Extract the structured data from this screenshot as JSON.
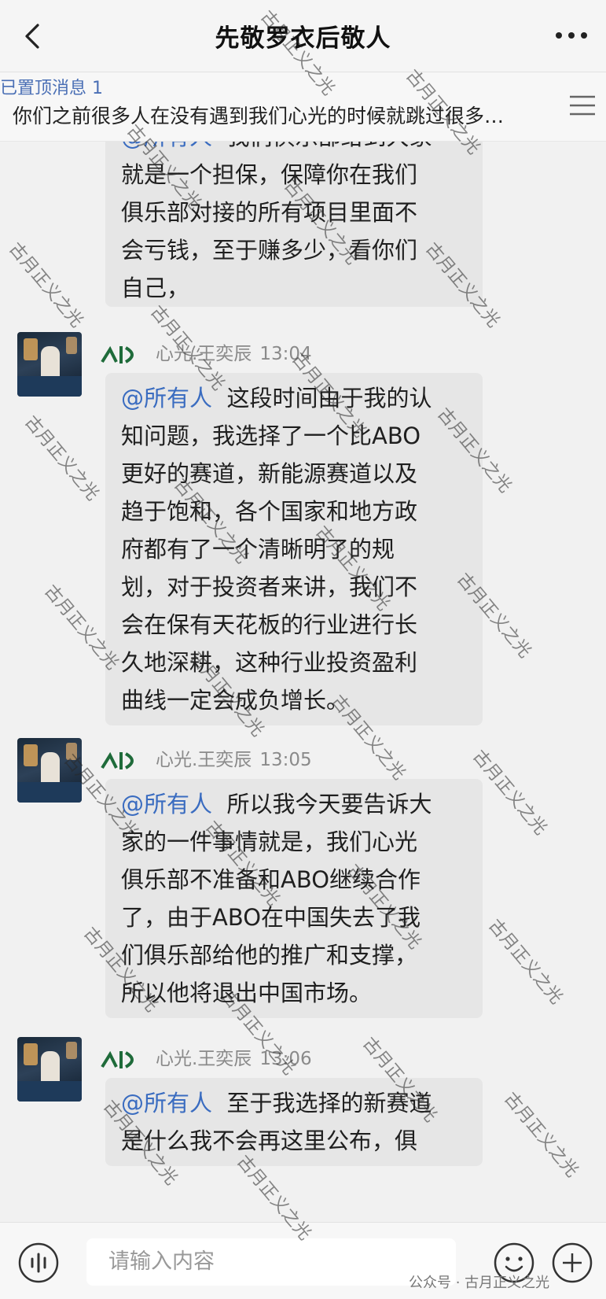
{
  "header": {
    "title": "先敬罗衣后敬人",
    "back_icon": "chevron-left-icon",
    "more_icon": "more-dots-icon"
  },
  "pinned": {
    "label": "已置顶消息 1",
    "text": "你们之前很多人在没有遇到我们心光的时候就跳过很多…",
    "menu_icon": "menu-lines-icon"
  },
  "messages": [
    {
      "partial": true,
      "mention": "@所有人",
      "lines": [
        "我们俱乐部给到大家",
        "就是一个担保，保障你在我们",
        "俱乐部对接的所有项目里面不",
        "会亏钱，至于赚多少，看你们",
        "自己，"
      ]
    },
    {
      "sender": "心光.王奕辰",
      "time": "13:04",
      "mention": "@所有人",
      "lines": [
        "这段时间由于我的认",
        "知问题，我选择了一个比ABO",
        "更好的赛道，新能源赛道以及",
        "趋于饱和，各个国家和地方政",
        "府都有了一个清晰明了的规",
        "划，对于投资者来讲，我们不",
        "会在保有天花板的行业进行长",
        "久地深耕，这种行业投资盈利",
        "曲线一定会成负增长。"
      ]
    },
    {
      "sender": "心光.王奕辰",
      "time": "13:05",
      "mention": "@所有人",
      "lines": [
        "所以我今天要告诉大",
        "家的一件事情就是，我们心光",
        "俱乐部不准备和ABO继续合作",
        "了，由于ABO在中国失去了我",
        "们俱乐部给他的推广和支撑，",
        "所以他将退出中国市场。"
      ]
    },
    {
      "sender": "心光.王奕辰",
      "time": "13:06",
      "mention": "@所有人",
      "lines": [
        "至于我选择的新赛道",
        "是什么我不会再这里公布，俱"
      ]
    }
  ],
  "input": {
    "placeholder": "请输入内容",
    "voice_icon": "voice-icon",
    "emoji_icon": "emoji-icon",
    "plus_icon": "plus-icon"
  },
  "watermark": {
    "text": "古月正义之光",
    "footer": "公众号 · 古月正义之光"
  },
  "colors": {
    "mention": "#3a6cc0",
    "badge_green": "#1f6b3a",
    "bubble": "#e6e6e6",
    "background": "#f1f1f1"
  }
}
